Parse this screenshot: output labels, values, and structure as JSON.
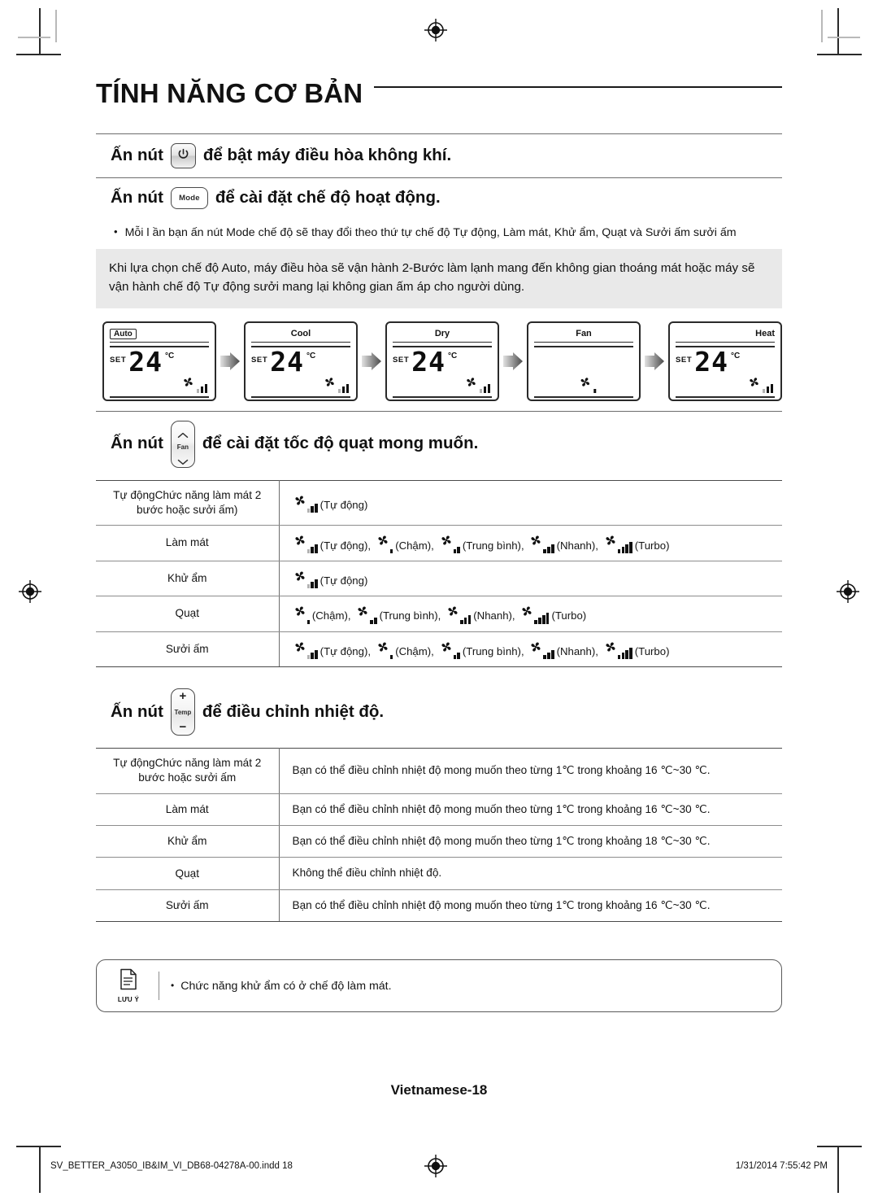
{
  "document": {
    "page_title": "TÍNH NĂNG CƠ BẢN",
    "page_label": "Vietnamese-18",
    "footer_file": "SV_BETTER_A3050_IB&IM_VI_DB68-04278A-00.indd   18",
    "footer_timestamp": "1/31/2014   7:55:42 PM"
  },
  "sections": {
    "power": {
      "prefix": "Ấn nút",
      "button_label": "power-icon",
      "suffix": "để bật máy điều hòa không khí."
    },
    "mode": {
      "prefix": "Ấn nút",
      "button_label": "Mode",
      "suffix": "để cài đặt chế độ hoạt động.",
      "bullet": "Mỗi l ần bạn ấn nút Mode chế độ sẽ thay đổi theo thứ tự chế độ Tự động, Làm mát, Khử ẩm, Quạt và Sưởi ấm sưởi ấm",
      "callout": "Khi lựa chọn chế độ Auto, máy điều hòa sẽ vận hành 2-Bước làm lạnh mang đến không gian thoáng mát hoặc máy sẽ vận hành chế độ Tự động sưởi mang lại không gian ấm áp cho người dùng."
    },
    "fan": {
      "prefix": "Ấn nút",
      "button_label": "Fan",
      "suffix": "để cài đặt tốc độ quạt mong muốn."
    },
    "temp": {
      "prefix": "Ấn nút",
      "button_label": "Temp",
      "plus": "+",
      "minus": "−",
      "suffix": "để điều chỉnh nhiệt độ."
    }
  },
  "lcd_panels": [
    {
      "mode": "Auto",
      "align": "left",
      "boxed": true,
      "set": "SET",
      "digits": "24",
      "unit": "°C",
      "fan_bars": 3,
      "fan_auto": true,
      "has_temp": true,
      "fan_center": false
    },
    {
      "mode": "Cool",
      "align": "center",
      "boxed": false,
      "set": "SET",
      "digits": "24",
      "unit": "°C",
      "fan_bars": 3,
      "fan_auto": true,
      "has_temp": true,
      "fan_center": false
    },
    {
      "mode": "Dry",
      "align": "center",
      "boxed": false,
      "set": "SET",
      "digits": "24",
      "unit": "°C",
      "fan_bars": 3,
      "fan_auto": true,
      "has_temp": true,
      "fan_center": false
    },
    {
      "mode": "Fan",
      "align": "center",
      "boxed": false,
      "set": "",
      "digits": "",
      "unit": "",
      "fan_bars": 1,
      "fan_auto": false,
      "has_temp": false,
      "fan_center": true
    },
    {
      "mode": "Heat",
      "align": "right",
      "boxed": false,
      "set": "SET",
      "digits": "24",
      "unit": "°C",
      "fan_bars": 3,
      "fan_auto": true,
      "has_temp": true,
      "fan_center": false
    }
  ],
  "fan_table": {
    "rows": [
      {
        "mode": "Tự độngChức năng làm mát 2 bước hoặc sưởi ấm)",
        "options": [
          {
            "caption": "(Tự động)",
            "bars": 3,
            "auto": true
          }
        ]
      },
      {
        "mode": "Làm mát",
        "options": [
          {
            "caption": "(Tự động),",
            "bars": 3,
            "auto": true
          },
          {
            "caption": "(Chậm),",
            "bars": 1,
            "auto": false
          },
          {
            "caption": "(Trung bình),",
            "bars": 2,
            "auto": false
          },
          {
            "caption": "(Nhanh),",
            "bars": 3,
            "auto": false
          },
          {
            "caption": "(Turbo)",
            "bars": 4,
            "auto": false
          }
        ]
      },
      {
        "mode": "Khử ẩm",
        "options": [
          {
            "caption": "(Tự động)",
            "bars": 3,
            "auto": true
          }
        ]
      },
      {
        "mode": "Quạt",
        "options": [
          {
            "caption": "(Chậm),",
            "bars": 1,
            "auto": false
          },
          {
            "caption": "(Trung bình),",
            "bars": 2,
            "auto": false
          },
          {
            "caption": "(Nhanh),",
            "bars": 3,
            "auto": false
          },
          {
            "caption": "(Turbo)",
            "bars": 4,
            "auto": false
          }
        ]
      },
      {
        "mode": "Sưởi ấm",
        "options": [
          {
            "caption": "(Tự động),",
            "bars": 3,
            "auto": true
          },
          {
            "caption": "(Chậm),",
            "bars": 1,
            "auto": false
          },
          {
            "caption": "(Trung bình),",
            "bars": 2,
            "auto": false
          },
          {
            "caption": "(Nhanh),",
            "bars": 3,
            "auto": false
          },
          {
            "caption": "(Turbo)",
            "bars": 4,
            "auto": false
          }
        ]
      }
    ]
  },
  "temp_table": {
    "rows": [
      {
        "mode": "Tự độngChức năng làm mát 2 bước hoặc sưởi ấm",
        "value": "Bạn có thể điều chỉnh nhiệt độ mong muốn theo từng 1℃ trong khoảng 16 ℃~30 ℃."
      },
      {
        "mode": "Làm mát",
        "value": "Bạn có thể điều chỉnh nhiệt độ mong muốn theo từng 1℃ trong khoảng 16 ℃~30 ℃."
      },
      {
        "mode": "Khử ẩm",
        "value": "Bạn có thể điều chỉnh nhiệt độ mong muốn theo từng 1℃ trong khoảng 18 ℃~30 ℃."
      },
      {
        "mode": "Quạt",
        "value": "Không thể điều chỉnh nhiệt độ."
      },
      {
        "mode": "Sưởi ấm",
        "value": "Bạn có thể điều chỉnh nhiệt độ mong muốn theo từng 1℃ trong khoảng 16 ℃~30 ℃."
      }
    ]
  },
  "note": {
    "icon_caption": "LƯU Ý",
    "bullet": "Chức năng khử ẩm có ở chế độ làm mát."
  }
}
